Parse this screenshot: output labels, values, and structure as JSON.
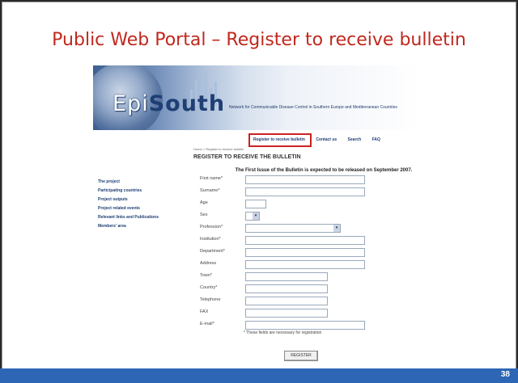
{
  "slide": {
    "title": "Public Web Portal – Register to receive bulletin",
    "page_number": "38"
  },
  "brand": {
    "logo_light": "Epi",
    "logo_bold": "South",
    "tagline": "Network for Communicable Disease Control in Southern Europe and Mediterranean Countries"
  },
  "topnav": {
    "items": [
      "Register to receive bulletin",
      "Contact us",
      "Search",
      "FAQ"
    ]
  },
  "breadcrumb": "Home > Register to receive bulletin",
  "heading": "REGISTER TO RECEIVE THE BULLETIN",
  "notice": "The First Issue of the Bulletin is expected to be released on September 2007.",
  "sidebar": {
    "items": [
      "The project",
      "Participating countries",
      "Project outputs",
      "Project related events",
      "Relevant links and Publications",
      "Members' area"
    ]
  },
  "form": {
    "fields": [
      {
        "label": "First name*"
      },
      {
        "label": "Surname*"
      },
      {
        "label": "Age"
      },
      {
        "label": "Sex"
      },
      {
        "label": "Profession*"
      },
      {
        "label": "Institution*"
      },
      {
        "label": "Department*"
      },
      {
        "label": "Address"
      },
      {
        "label": "Town*"
      },
      {
        "label": "Country*"
      },
      {
        "label": "Telephone"
      },
      {
        "label": "FAX"
      },
      {
        "label": "E-mail*"
      }
    ],
    "footnote": "* These fields are necessary for registration",
    "submit_label": "REGISTER"
  },
  "colors": {
    "title": "#c0281e",
    "bar": "#2d66b5",
    "highlight": "#cc2222",
    "nav": "#1f3e73"
  }
}
